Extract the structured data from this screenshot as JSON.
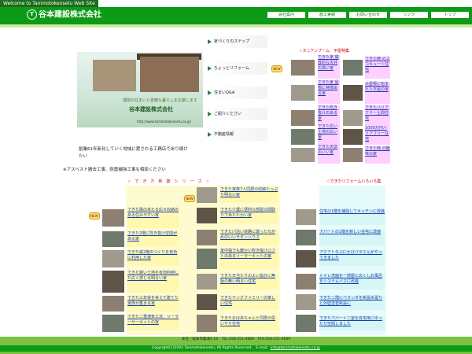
{
  "site": {
    "welcome": "Welcome to Tanimotokensetu Web Site",
    "company": "谷本建設株式会社",
    "logo_mark": "T"
  },
  "nav": [
    "会社案内",
    "施工実績",
    "お問い合わせ",
    "リンク",
    "トップ"
  ],
  "hero": {
    "tagline": "理想の住まいと素敵な暮らしを応援します",
    "company": "谷本建設株式会社",
    "url": "http://www.tanimotokensetu.co.jp/"
  },
  "side_menu": [
    "家づくりのステップ",
    "ちょっとリフォーム",
    "住まいQ&A",
    "ご紹介ください",
    "不動産情報"
  ],
  "new_badge": "NEW",
  "intro": {
    "line1": "創業61年新化していく地域に愛される工務店であり続けたい",
    "line2": "※アスベスト撤去工事、耐震補強工事も相談ください"
  },
  "feature": {
    "heading": "☆タニケンブーム　平屋特集",
    "left": [
      "できた家 開放的な天井の高い家",
      "できた家 屋根に特徴ある家",
      "できた吹き抜けのある家",
      "できた広い土地の広い家",
      "できた天窓のいい家"
    ],
    "right": [
      "できた時 のエコキュート住宅",
      "大屋根に包まれた平屋の家",
      "できたバリアフリー土間住宅",
      "1000万円バリアフリー住宅",
      "できた時 の趣味の家"
    ]
  },
  "new_series": {
    "heading": "☆　で　き　た　新　築　シ　リ　ー　ズ　☆",
    "col1": [
      "できた陽のあたる広々収納のある住みやすい家",
      "できた2階に吹き抜け空間がある家",
      "できた縦2階のつくりを有効に利用した家",
      "できた狭い土地を有効利用した広く感じる明るい家",
      "できた三年後を考えて建てた家族が集まる家",
      "できた二重通気工法、ソーラーサーキットの家"
    ],
    "col2": [
      "できた家族7人同居の収納たっぷり明るい家",
      "できた介護に便利な部屋の間取りであたたかい家",
      "できた川沿い道路に建ったながめのいいモダンハウス",
      "家中独でも暖かい吹き抜けロフトのあるソーラーキットの家",
      "できた日当たりのよい設計に無駄の無い明るい住宅",
      "できたヤングファミリーの楽しい住宅",
      "できたおばあちゃんと同居の思いやり住宅"
    ]
  },
  "reform": {
    "heading": "☆できたリフォームいろいろ集",
    "items": [
      "住宅の1階を補強してキッチンに改装",
      "アパートの1階を新しい住宅に改装",
      "アクアトタぶにかびパラエんがやってきました",
      "トイレ洗面を一部屋に広くしお風呂をシステムバスに改装",
      "できた二階にベランダを新設水廻りと外壁塗替新設に",
      "できたアパート二室を自宅用にゆったり空間しました"
    ]
  },
  "footer": {
    "address": "本社／岐阜市都通4-19　TEL.058-251-4889　FAX.058-251-4699",
    "copyright": "Copyright(C)2002 Tanimotokensetu, All Rights Reserved.　E-mail：",
    "email": "info@tanimotokensetu.co.jp"
  },
  "colors": {
    "header_green": "#0c9a17",
    "footer_green": "#7cc142",
    "highlight_yellow": "#fff8b0",
    "highlight_pink": "#ffd0ff",
    "highlight_cyan": "#d6f6f6",
    "heading_red": "#cc0000",
    "link_blue": "#1a3fb0"
  }
}
